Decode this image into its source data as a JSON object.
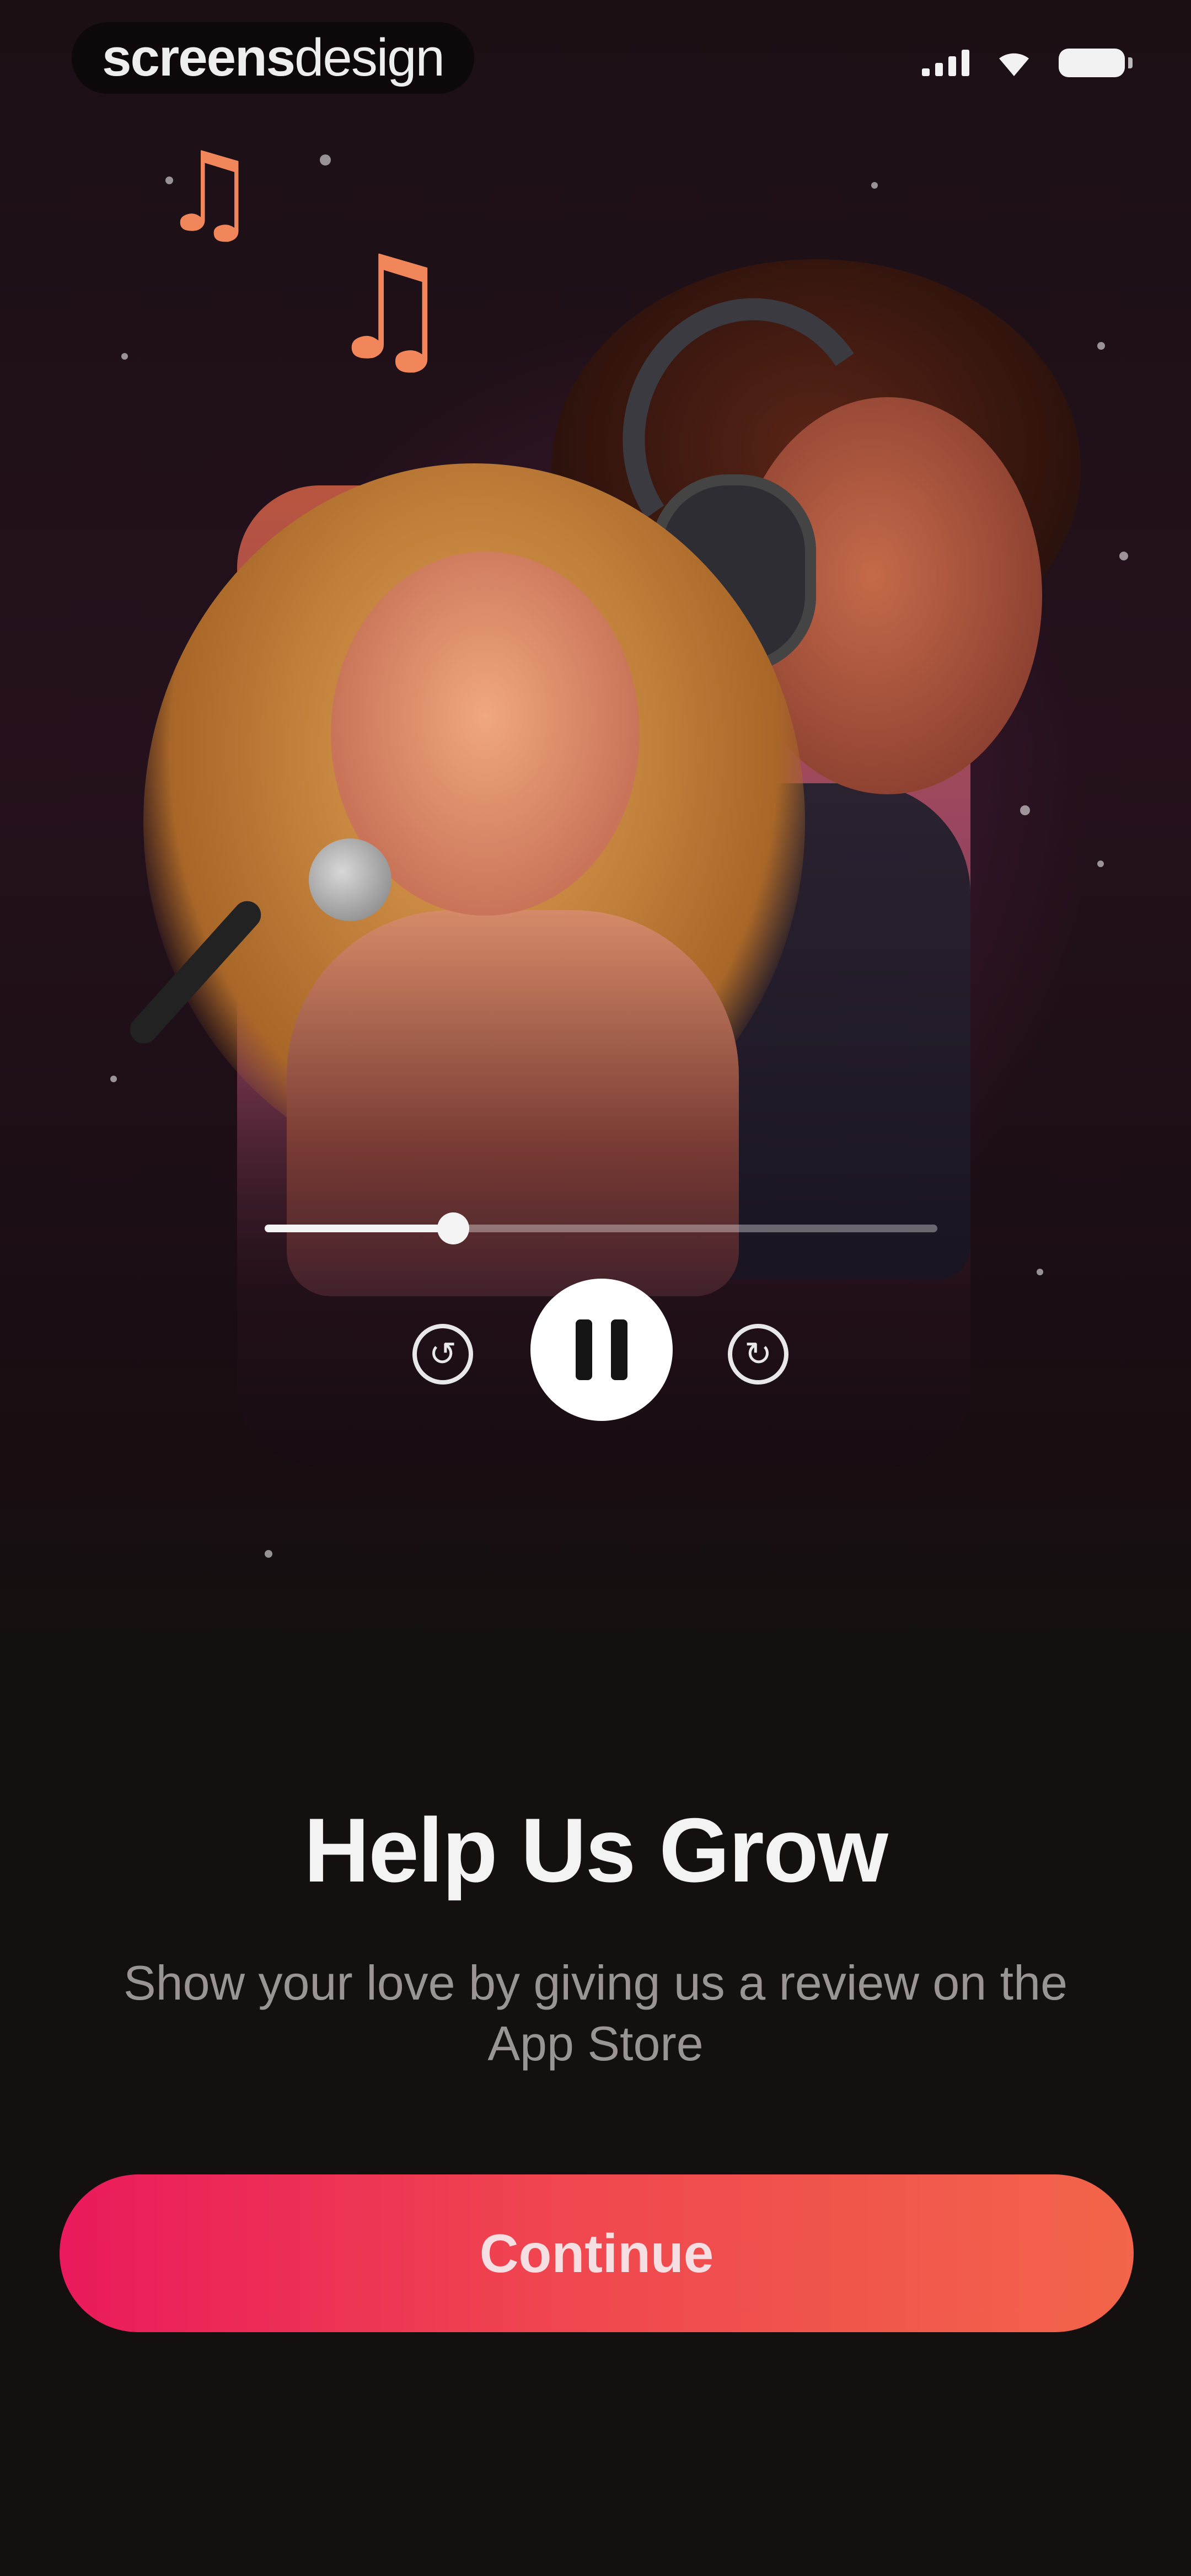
{
  "status_bar": {
    "brand_light": "screens",
    "brand_regular": "design",
    "icons": [
      "cellular-signal-icon",
      "wifi-icon",
      "battery-icon"
    ]
  },
  "hero": {
    "image_description_icon": "singers-illustration",
    "decorations": [
      "music-note-icon",
      "music-note-icon"
    ]
  },
  "player": {
    "progress": 0.28,
    "rewind_icon": "↺",
    "forward_icon": "↻",
    "state": "playing"
  },
  "content": {
    "title": "Help Us Grow",
    "subtitle": "Show your love by giving us a review on the App Store"
  },
  "cta": {
    "label": "Continue"
  },
  "colors": {
    "background": "#151010",
    "accent_start": "#ea1a5c",
    "accent_end": "#f2654a",
    "note": "#f0865a"
  }
}
